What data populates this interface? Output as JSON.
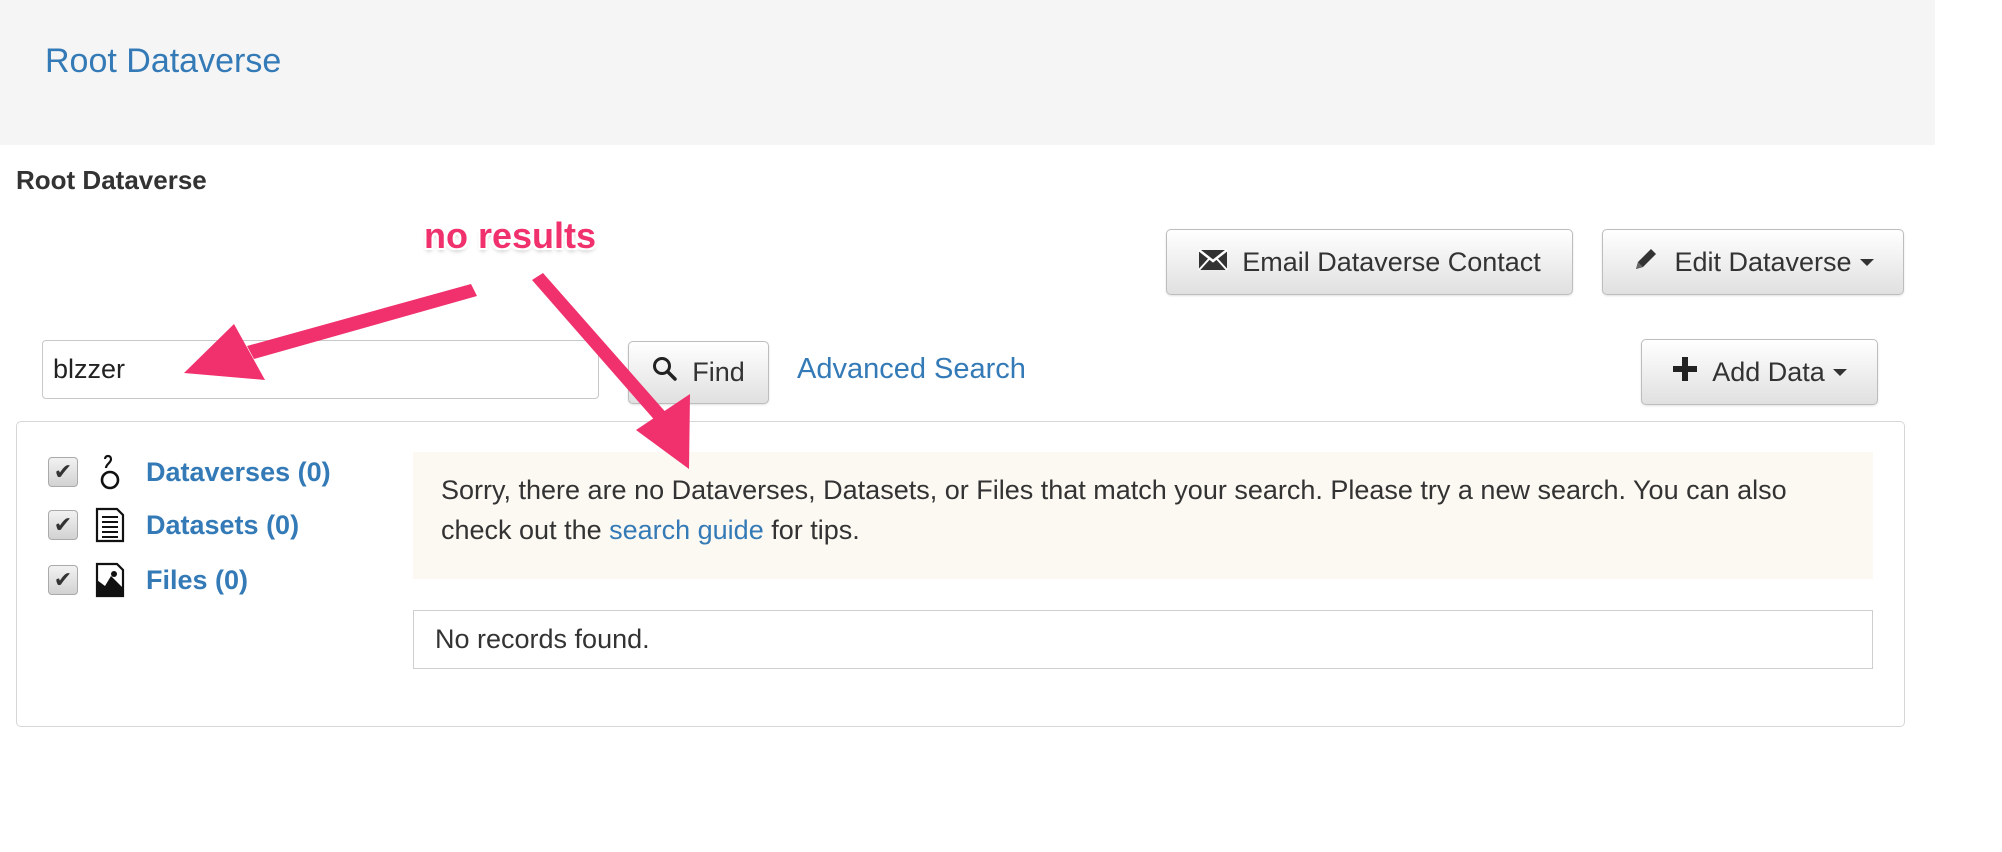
{
  "header": {
    "brand": "Root Dataverse"
  },
  "page": {
    "title": "Root Dataverse"
  },
  "actions": {
    "email_contact": "Email Dataverse Contact",
    "edit_dataverse": "Edit Dataverse",
    "add_data": "Add Data"
  },
  "search": {
    "value": "blzzer",
    "find_label": "Find",
    "advanced_label": "Advanced Search"
  },
  "facets": [
    {
      "label": "Dataverses (0)",
      "checked": true,
      "icon": "dataverse-icon"
    },
    {
      "label": "Datasets (0)",
      "checked": true,
      "icon": "dataset-icon"
    },
    {
      "label": "Files (0)",
      "checked": true,
      "icon": "file-icon"
    }
  ],
  "message": {
    "text_before": "Sorry, there are no Dataverses, Datasets, or Files that match your search. Please try a new search. You can also check out the ",
    "link": "search guide",
    "text_after": " for tips."
  },
  "records": {
    "text": "No records found."
  },
  "annotation": {
    "label": "no results",
    "color": "#f0316d"
  },
  "colors": {
    "link": "#337ab7",
    "header_bg": "#f5f5f5",
    "alert_bg": "#fcf8f2"
  }
}
